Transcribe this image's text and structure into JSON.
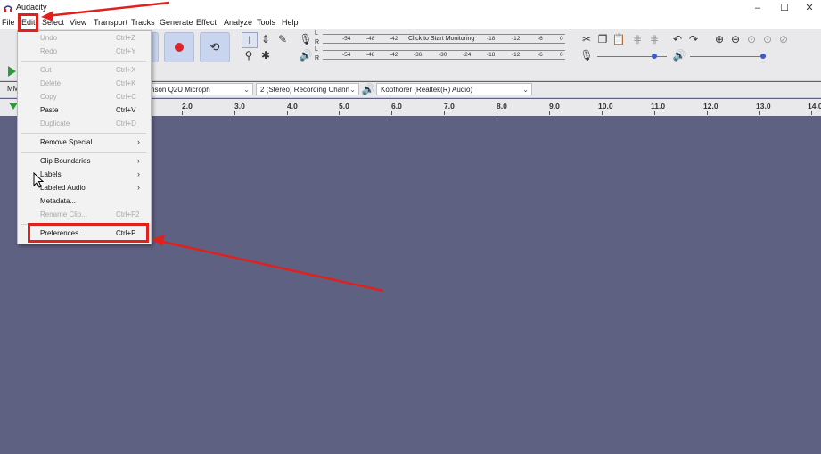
{
  "window": {
    "title": "Audacity",
    "controls": [
      "–",
      "☐",
      "✕"
    ]
  },
  "menubar": [
    "File",
    "Edit",
    "Select",
    "View",
    "Transport",
    "Tracks",
    "Generate",
    "Effect",
    "Analyze",
    "Tools",
    "Help"
  ],
  "meters": {
    "record_prompt": "Click to Start Monitoring",
    "record_ticks": [
      "-54",
      "-48",
      "-42",
      "-18",
      "-12",
      "-6",
      "0"
    ],
    "play_ticks": [
      "-54",
      "-48",
      "-42",
      "-36",
      "-30",
      "-24",
      "-18",
      "-12",
      "-6",
      "0"
    ],
    "channel_l": "L",
    "channel_r": "R"
  },
  "device_toolbar": {
    "host": "MM",
    "record_device": "Samson Q2U Microph",
    "channels": "2 (Stereo) Recording Chann",
    "playback_device": "Kopfhörer (Realtek(R) Audio)"
  },
  "ruler": [
    "2.0",
    "3.0",
    "4.0",
    "5.0",
    "6.0",
    "7.0",
    "8.0",
    "9.0",
    "10.0",
    "11.0",
    "12.0",
    "13.0",
    "14.0"
  ],
  "edit_menu": {
    "items": [
      {
        "label": "Undo",
        "shortcut": "Ctrl+Z",
        "disabled": true
      },
      {
        "label": "Redo",
        "shortcut": "Ctrl+Y",
        "disabled": true
      },
      {
        "label": "Cut",
        "shortcut": "Ctrl+X",
        "disabled": true
      },
      {
        "label": "Delete",
        "shortcut": "Ctrl+K",
        "disabled": true
      },
      {
        "label": "Copy",
        "shortcut": "Ctrl+C",
        "disabled": true
      },
      {
        "label": "Paste",
        "shortcut": "Ctrl+V",
        "disabled": false
      },
      {
        "label": "Duplicate",
        "shortcut": "Ctrl+D",
        "disabled": true
      },
      {
        "label": "Remove Special",
        "shortcut": "",
        "submenu": true
      },
      {
        "label": "Clip Boundaries",
        "shortcut": "",
        "submenu": true
      },
      {
        "label": "Labels",
        "shortcut": "",
        "submenu": true
      },
      {
        "label": "Labeled Audio",
        "shortcut": "",
        "submenu": true
      },
      {
        "label": "Metadata...",
        "shortcut": "",
        "disabled": false
      },
      {
        "label": "Rename Clip...",
        "shortcut": "Ctrl+F2",
        "disabled": true
      },
      {
        "label": "Preferences...",
        "shortcut": "Ctrl+P",
        "disabled": false
      }
    ]
  },
  "colors": {
    "accent": "#e0201c",
    "track_bg": "#5f6182",
    "toolbar_bg": "#e9e9ec"
  }
}
